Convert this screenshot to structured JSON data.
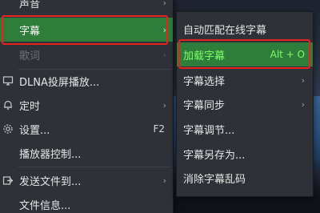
{
  "menu": {
    "items": [
      {
        "label": "声音",
        "icon": "",
        "arrow": "›"
      },
      {
        "label": "字幕",
        "icon": "",
        "arrow": "›"
      },
      {
        "label": "歌词",
        "icon": "",
        "arrow": "›"
      },
      {
        "label": "DLNA投屏播放...",
        "icon": "cast-icon",
        "arrow": ""
      },
      {
        "label": "定时",
        "icon": "bell-icon",
        "arrow": "›"
      },
      {
        "label": "设置...",
        "icon": "gear-icon",
        "shortcut": "F2"
      },
      {
        "label": "播放器控制...",
        "icon": ""
      },
      {
        "label": "发送文件到...",
        "icon": "send-icon",
        "arrow": "›"
      },
      {
        "label": "文件信息...",
        "icon": ""
      }
    ]
  },
  "submenu": {
    "items": [
      {
        "label": "自动匹配在线字幕",
        "arrow": ""
      },
      {
        "label": "加载字幕",
        "shortcut": "Alt + O"
      },
      {
        "label": "字幕选择",
        "arrow": "›"
      },
      {
        "label": "字幕同步",
        "arrow": "›"
      },
      {
        "label": "字幕调节...",
        "arrow": ""
      },
      {
        "label": "字幕另存为...",
        "arrow": ""
      },
      {
        "label": "消除字幕乱码",
        "arrow": ""
      }
    ]
  },
  "colors": {
    "active_bg": "#2f7d3a",
    "highlight_border": "#e8231e",
    "green_text": "#7dff6a"
  }
}
